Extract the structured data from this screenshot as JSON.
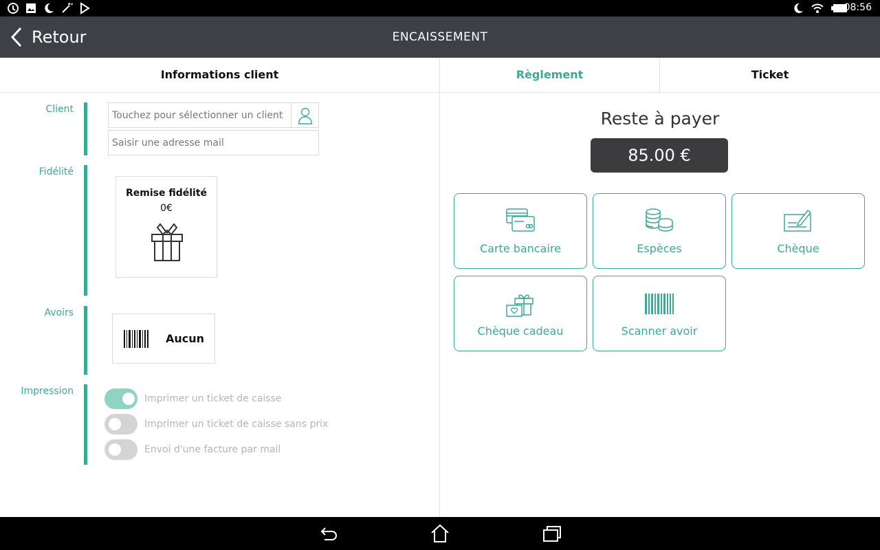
{
  "status_bar": {
    "time": "08:56",
    "left_icons": [
      "sync-icon",
      "image-icon",
      "moon-icon",
      "magic-wand-icon",
      "play-store-icon"
    ],
    "right_icons": [
      "moon-icon",
      "wifi-icon",
      "battery-icon"
    ]
  },
  "header": {
    "back_label": "Retour",
    "title": "ENCAISSEMENT"
  },
  "tabs": [
    {
      "label": "Informations client",
      "active": false
    },
    {
      "label": "Règlement",
      "active": true
    },
    {
      "label": "Ticket",
      "active": false
    }
  ],
  "left": {
    "client": {
      "label": "Client",
      "select_placeholder": "Touchez pour sélectionner un client",
      "email_placeholder": "Saisir une adresse mail",
      "user_icon": "user-icon"
    },
    "fidelite": {
      "label": "Fidélité",
      "card_title": "Remise fidélité",
      "card_value": "0€",
      "icon": "gift-icon"
    },
    "avoirs": {
      "label": "Avoirs",
      "value": "Aucun",
      "icon": "barcode-icon"
    },
    "impression": {
      "label": "Impression",
      "options": [
        {
          "label": "Imprimer un ticket de caisse",
          "on": true
        },
        {
          "label": "Imprimer un ticket de caisse sans prix",
          "on": false
        },
        {
          "label": "Envoi d'une facture par mail",
          "on": false
        }
      ]
    }
  },
  "right": {
    "remaining_label": "Reste à payer",
    "amount": "85.00 €",
    "payment_methods": [
      {
        "label": "Carte bancaire",
        "icon": "credit-card-icon"
      },
      {
        "label": "Espèces",
        "icon": "coins-icon"
      },
      {
        "label": "Chèque",
        "icon": "cheque-icon"
      },
      {
        "label": "Chèque cadeau",
        "icon": "gift-card-icon"
      },
      {
        "label": "Scanner avoir",
        "icon": "barcode-icon"
      }
    ]
  },
  "nav_bar": {
    "icons": [
      "back-nav-icon",
      "home-nav-icon",
      "recents-nav-icon"
    ]
  },
  "colors": {
    "accent": "#3aaa98",
    "header_bg": "#3f3f48",
    "amount_bg": "#3c3c3f",
    "toggle_on": "#8fd3c4",
    "toggle_off": "#d4d4d4"
  }
}
